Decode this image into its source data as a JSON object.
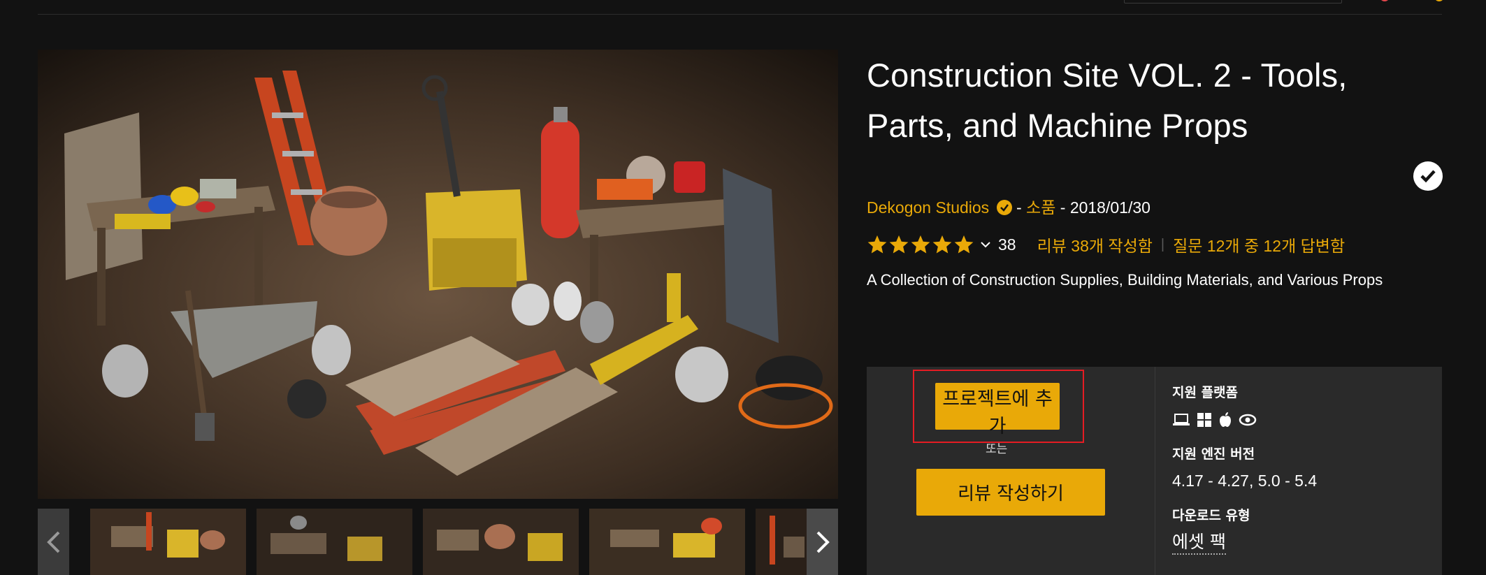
{
  "product": {
    "title": "Construction Site VOL. 2 - Tools, Parts, and Machine Props",
    "seller": "Dekogon Studios",
    "separator": "-",
    "category": "소품",
    "date": "2018/01/30",
    "rating_stars": 5,
    "rating_count": "38",
    "reviews_link": "리뷰 38개 작성함",
    "questions_link": "질문 12개 중 12개 답변함",
    "divider": "|",
    "description": "A Collection of Construction Supplies, Building Materials, and Various Props"
  },
  "purchase": {
    "add_to_project": "프로젝트에 추가",
    "or_label": "또는",
    "write_review": "리뷰 작성하기"
  },
  "specs": {
    "platforms_label": "지원 플랫폼",
    "platforms": [
      "laptop-icon",
      "windows-icon",
      "apple-icon",
      "eye-icon"
    ],
    "engine_label": "지원 엔진 버전",
    "engine_versions": "4.17 - 4.27, 5.0 - 5.4",
    "download_label": "다운로드 유형",
    "download_type": "에셋 팩"
  },
  "colors": {
    "accent": "#e9a908",
    "background": "#121212",
    "panel": "#2a2a2a",
    "highlight": "#e51c23"
  }
}
